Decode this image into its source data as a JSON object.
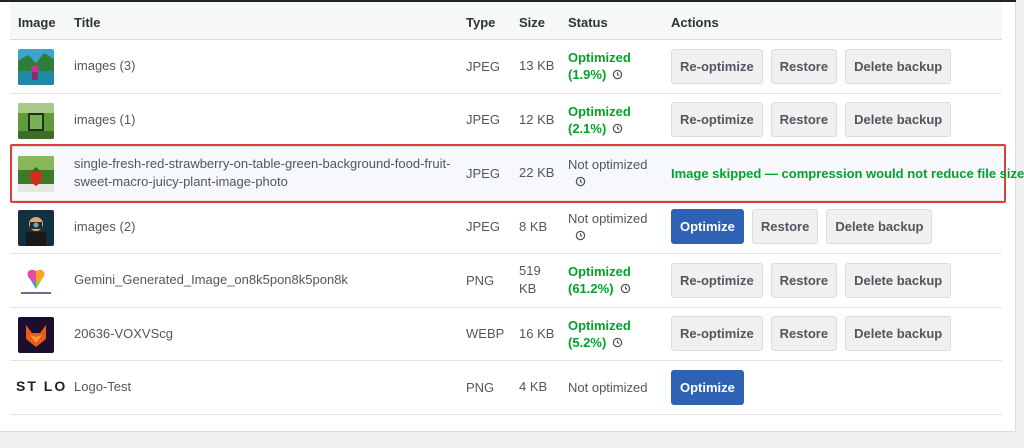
{
  "table": {
    "headers": {
      "image": "Image",
      "title": "Title",
      "type": "Type",
      "size": "Size",
      "status": "Status",
      "actions": "Actions"
    },
    "rows": [
      {
        "title": "images (3)",
        "type": "JPEG",
        "size": "13 KB",
        "status": "Optimized",
        "percent": "(1.9%)",
        "actions": [
          "Re-optimize",
          "Restore",
          "Delete backup"
        ]
      },
      {
        "title": "images (1)",
        "type": "JPEG",
        "size": "12 KB",
        "status": "Optimized",
        "percent": "(2.1%)",
        "actions": [
          "Re-optimize",
          "Restore",
          "Delete backup"
        ]
      },
      {
        "title": "single-fresh-red-strawberry-on-table-green-background-food-fruit-sweet-macro-juicy-plant-image-photo",
        "type": "JPEG",
        "size": "22 KB",
        "status": "Not optimized",
        "message": "Image skipped — compression would not reduce file size."
      },
      {
        "title": "images (2)",
        "type": "JPEG",
        "size": "8 KB",
        "status": "Not optimized",
        "actions": [
          "Optimize",
          "Restore",
          "Delete backup"
        ]
      },
      {
        "title": "Gemini_Generated_Image_on8k5pon8k5pon8k",
        "type": "PNG",
        "size": "519 KB",
        "status": "Optimized",
        "percent": "(61.2%)",
        "actions": [
          "Re-optimize",
          "Restore",
          "Delete backup"
        ]
      },
      {
        "title": "20636-VOXVScg",
        "type": "WEBP",
        "size": "16 KB",
        "status": "Optimized",
        "percent": "(5.2%)",
        "actions": [
          "Re-optimize",
          "Restore",
          "Delete backup"
        ]
      },
      {
        "title": "Logo-Test",
        "type": "PNG",
        "size": "4 KB",
        "status": "Not optimized",
        "thumb_text": "ST LO",
        "actions": [
          "Optimize"
        ]
      }
    ]
  },
  "colors": {
    "optimized": "#00a32a",
    "primary_button": "#2f62b5",
    "highlight_border": "#dc3f3a"
  }
}
